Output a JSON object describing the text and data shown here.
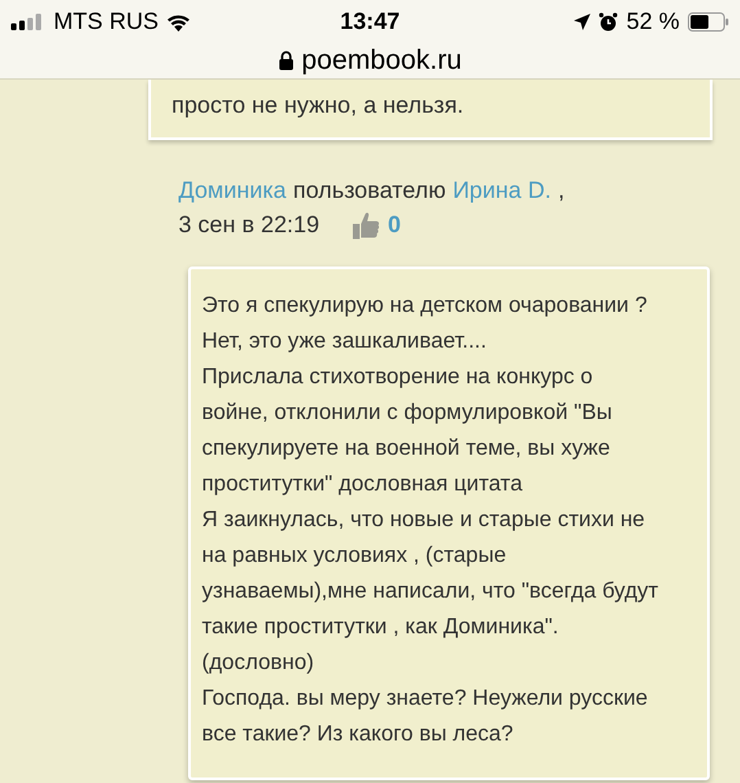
{
  "status_bar": {
    "carrier": "MTS RUS",
    "time": "13:47",
    "battery": "52 %"
  },
  "address_bar": {
    "url": "poembook.ru"
  },
  "previous_comment": {
    "text": "просто не нужно, а нельзя."
  },
  "comment": {
    "author": "Доминика",
    "connector": "пользователю",
    "recipient": "Ирина D.",
    "separator": ",",
    "date": "3 сен в 22:19",
    "likes": "0",
    "lines": [
      "Это я спекулирую на детском очаровании ?",
      "Нет, это уже зашкаливает....",
      "Прислала стихотворение на конкурс о",
      "войне, отклонили с формулировкой \"Вы",
      "спекулируете на военной теме, вы хуже",
      "проститутки\" дословная цитата",
      "Я заикнулась, что новые и старые стихи не",
      "на равных условиях , (старые",
      "узнаваемы),мне написали, что \"всегда будут",
      "такие проститутки , как Доминика\".",
      "(дословно)",
      "Господа. вы меру знаете? Неужели русские",
      "все такие? Из какого вы леса?"
    ]
  }
}
